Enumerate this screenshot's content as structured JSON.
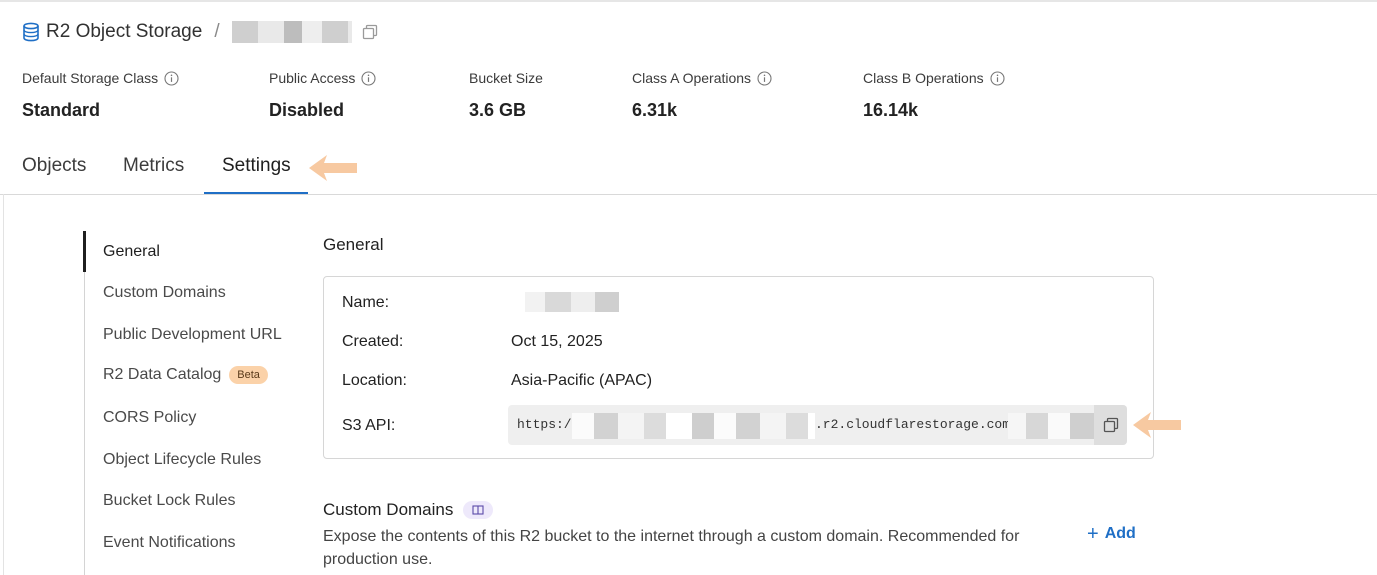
{
  "breadcrumb": {
    "title": "R2 Object Storage",
    "separator": "/"
  },
  "stats": [
    {
      "label": "Default Storage Class",
      "value": "Standard",
      "info": true
    },
    {
      "label": "Public Access",
      "value": "Disabled",
      "info": true
    },
    {
      "label": "Bucket Size",
      "value": "3.6 GB",
      "info": false
    },
    {
      "label": "Class A Operations",
      "value": "6.31k",
      "info": true
    },
    {
      "label": "Class B Operations",
      "value": "16.14k",
      "info": true
    }
  ],
  "tabs": [
    {
      "label": "Objects",
      "active": false
    },
    {
      "label": "Metrics",
      "active": false
    },
    {
      "label": "Settings",
      "active": true
    }
  ],
  "side_nav": [
    {
      "label": "General",
      "active": true
    },
    {
      "label": "Custom Domains"
    },
    {
      "label": "Public Development URL"
    },
    {
      "label": "R2 Data Catalog",
      "badge": "Beta"
    },
    {
      "label": "CORS Policy"
    },
    {
      "label": "Object Lifecycle Rules"
    },
    {
      "label": "Bucket Lock Rules"
    },
    {
      "label": "Event Notifications"
    }
  ],
  "general": {
    "title": "General",
    "rows": [
      {
        "label": "Name:",
        "value": ""
      },
      {
        "label": "Created:",
        "value": "Oct 15, 2025"
      },
      {
        "label": "Location:",
        "value": "Asia-Pacific (APAC)"
      },
      {
        "label": "S3 API:",
        "value_prefix": "https://",
        "value_middle": ".r2.cloudflarestorage.com/"
      }
    ]
  },
  "custom_domains": {
    "title": "Custom Domains",
    "description": "Expose the contents of this R2 bucket to the internet through a custom domain. Recommended for production use.",
    "add_label": "Add"
  },
  "colors": {
    "accent": "#1f6fc6",
    "arrow": "#f7c9a1",
    "beta_badge": "#fbd2a9"
  },
  "icons": [
    "database-icon",
    "copy-icon",
    "info-icon",
    "arrow-left-icon",
    "book-icon",
    "plus-icon"
  ]
}
